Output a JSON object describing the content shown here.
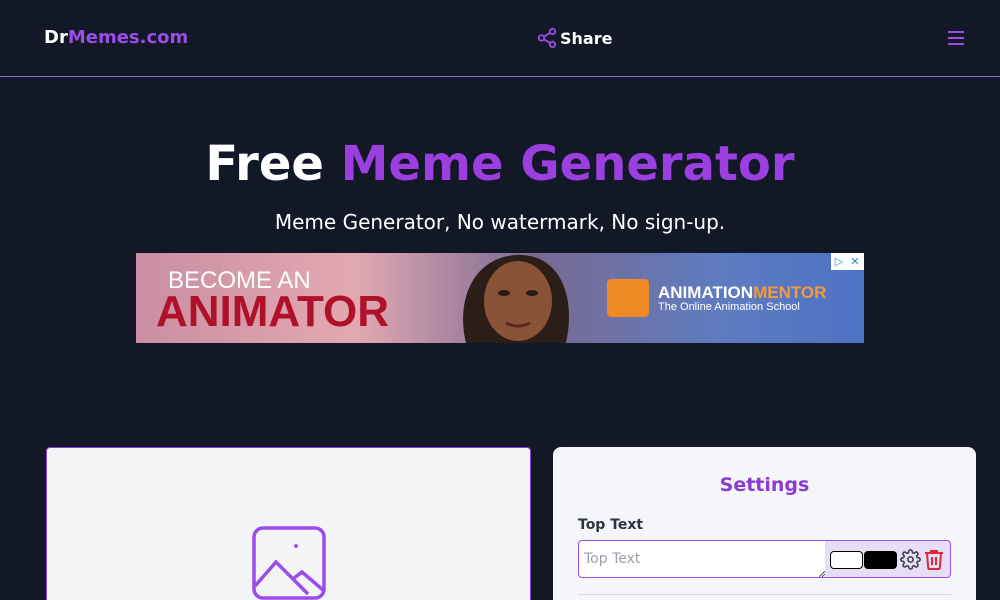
{
  "header": {
    "logo_prefix": "Dr",
    "logo_accent": "Memes.com",
    "share_label": "Share"
  },
  "hero": {
    "title_plain": "Free",
    "title_accent": "Meme Generator",
    "subtitle": "Meme Generator, No watermark, No sign-up."
  },
  "ad": {
    "line1": "BECOME AN",
    "line2": "ANIMATOR",
    "brand_part1": "ANIMATION",
    "brand_part2": "MENTOR",
    "tagline": "The Online Animation School"
  },
  "settings": {
    "title": "Settings",
    "top_text_label": "Top Text",
    "top_text_placeholder": "Top Text",
    "top_text_value": "",
    "text_color": "#ffffff",
    "outline_color": "#000000"
  },
  "colors": {
    "accent": "#9b4dea",
    "background": "#121826",
    "delete": "#e0283c"
  }
}
